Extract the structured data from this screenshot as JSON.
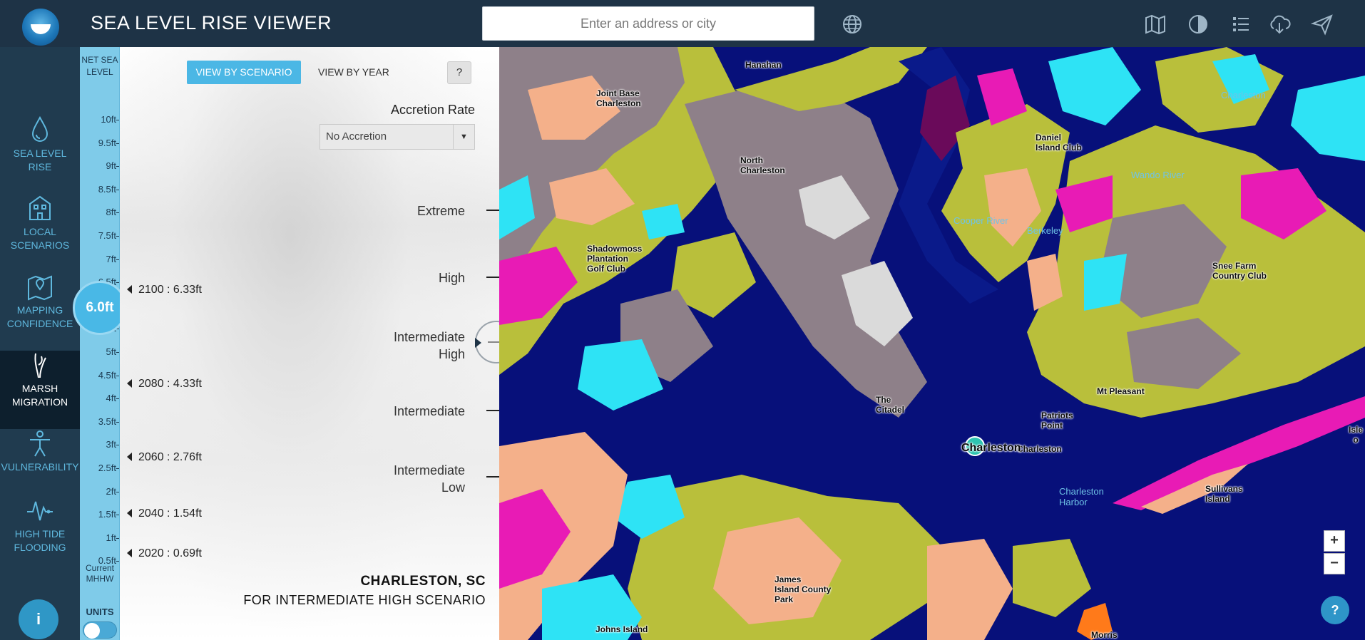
{
  "header": {
    "title": "SEA LEVEL RISE VIEWER",
    "search_placeholder": "Enter an address or city",
    "icons": [
      "globe-icon",
      "map-icon",
      "contrast-icon",
      "legend-list-icon",
      "cloud-download-icon",
      "share-icon"
    ]
  },
  "nav": {
    "items": [
      {
        "label_l1": "SEA LEVEL",
        "label_l2": "RISE",
        "icon": "water-drop-icon"
      },
      {
        "label_l1": "LOCAL",
        "label_l2": "SCENARIOS",
        "icon": "building-icon"
      },
      {
        "label_l1": "MAPPING",
        "label_l2": "CONFIDENCE",
        "icon": "map-pin-icon"
      },
      {
        "label_l1": "MARSH",
        "label_l2": "MIGRATION",
        "icon": "marsh-grass-icon",
        "active": true
      },
      {
        "label_l1": "VULNERABILITY",
        "label_l2": "",
        "icon": "person-icon"
      },
      {
        "label_l1": "HIGH TIDE",
        "label_l2": "FLOODING",
        "icon": "tide-wave-icon"
      }
    ],
    "info_label": "i"
  },
  "levelbar": {
    "head_l1": "NET SEA",
    "head_l2": "LEVEL",
    "ticks": [
      "10ft",
      "9.5ft",
      "9ft",
      "8.5ft",
      "8ft",
      "7.5ft",
      "7ft",
      "6.5ft",
      "6ft",
      "5.5ft",
      "5ft",
      "4.5ft",
      "4ft",
      "3.5ft",
      "3ft",
      "2.5ft",
      "2ft",
      "1.5ft",
      "1ft",
      "0.5ft"
    ],
    "mhhw_l1": "Current",
    "mhhw_l2": "MHHW",
    "units_label": "UNITS",
    "current_level": "6.0ft",
    "current_level_ft": 6.0
  },
  "panel": {
    "tab_scenario": "VIEW BY SCENARIO",
    "tab_year": "VIEW BY YEAR",
    "help": "?",
    "accretion_label": "Accretion Rate",
    "accretion_value": "No Accretion",
    "scenarios": [
      {
        "l1": "Extreme",
        "l2": ""
      },
      {
        "l1": "High",
        "l2": ""
      },
      {
        "l1": "Intermediate",
        "l2": "High"
      },
      {
        "l1": "Intermediate",
        "l2": ""
      },
      {
        "l1": "Intermediate",
        "l2": "Low"
      }
    ],
    "years": [
      "2100 : 6.33ft",
      "2080 : 4.33ft",
      "2060 : 2.76ft",
      "2040 : 1.54ft",
      "2020 : 0.69ft"
    ],
    "city": "CHARLESTON, SC",
    "city_sub": "FOR INTERMEDIATE HIGH SCENARIO"
  },
  "map": {
    "labels": [
      {
        "text": "Hanahan",
        "l": 345,
        "t": 18
      },
      {
        "text": "Joint Base",
        "l": 136,
        "t": 58
      },
      {
        "text": "Charleston",
        "l": 136,
        "t": 72
      },
      {
        "text": "North",
        "l": 338,
        "t": 152
      },
      {
        "text": "Charleston",
        "l": 338,
        "t": 166
      },
      {
        "text": "Daniel",
        "l": 752,
        "t": 120
      },
      {
        "text": "Island Club",
        "l": 752,
        "t": 134
      },
      {
        "text": "Shadowmoss",
        "l": 123,
        "t": 276
      },
      {
        "text": "Plantation",
        "l": 123,
        "t": 290
      },
      {
        "text": "Golf Club",
        "l": 123,
        "t": 304
      },
      {
        "text": "Snee Farm",
        "l": 1000,
        "t": 300
      },
      {
        "text": "Country Club",
        "l": 1000,
        "t": 314
      },
      {
        "text": "Mt Pleasant",
        "l": 838,
        "t": 476
      },
      {
        "text": "The",
        "l": 528,
        "t": 488
      },
      {
        "text": "Citadel",
        "l": 528,
        "t": 502
      },
      {
        "text": "Patriots",
        "l": 760,
        "t": 510
      },
      {
        "text": "Point",
        "l": 760,
        "t": 524
      },
      {
        "text": "Charleston",
        "l": 726,
        "t": 557
      },
      {
        "text": "Sullivans",
        "l": 990,
        "t": 613
      },
      {
        "text": "Island",
        "l": 990,
        "t": 627
      },
      {
        "text": "James",
        "l": 386,
        "t": 740
      },
      {
        "text": "Island County",
        "l": 386,
        "t": 754
      },
      {
        "text": "Park",
        "l": 386,
        "t": 768
      },
      {
        "text": "Johns Island",
        "l": 135,
        "t": 810
      },
      {
        "text": "Morris",
        "l": 830,
        "t": 818
      },
      {
        "text": "Isle o",
        "l": 1188,
        "t": 530
      }
    ],
    "water_labels": [
      {
        "text": "Wando River",
        "l": 886,
        "t": 172
      },
      {
        "text": "Charleston",
        "l": 785,
        "t": 616
      },
      {
        "text": "Harbor",
        "l": 785,
        "t": 631
      },
      {
        "text": "Cooper River",
        "l": 637,
        "t": 236
      },
      {
        "text": "Berkeley",
        "l": 740,
        "t": 250
      },
      {
        "text": "Charleston",
        "l": 1012,
        "t": 60
      }
    ],
    "zoom_in": "+",
    "zoom_out": "−",
    "help": "?"
  },
  "colors": {
    "header_bg": "#1e3346",
    "nav_accent": "#5fb8de",
    "level_bar": "#7fcbe9",
    "level_bubble": "#49b8e6",
    "water": "#07107a",
    "marsh_cyan": "#2ee3f5",
    "upland": "#f4b08a",
    "developed": "#8e8089",
    "transitional": "#b9bf3b",
    "unconsolidated": "#e81bb5"
  }
}
